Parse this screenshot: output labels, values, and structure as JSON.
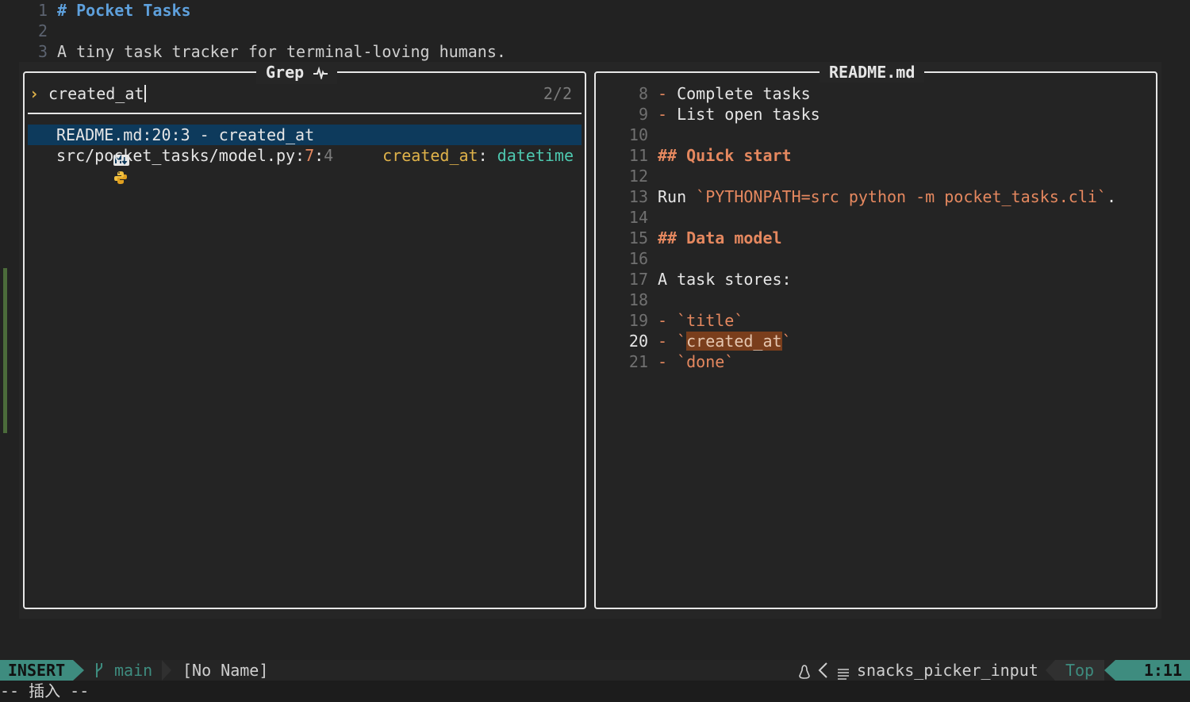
{
  "buffer": {
    "lines": [
      {
        "num": "1",
        "text": "# Pocket Tasks"
      },
      {
        "num": "2",
        "text": ""
      },
      {
        "num": "3",
        "text": "A tiny task tracker for terminal-loving humans."
      }
    ]
  },
  "picker": {
    "title": "Grep",
    "title_icon": "pulse-icon",
    "prompt_icon": "›",
    "query": "created_at",
    "count": "2/2",
    "results": [
      {
        "icon": "markdown-icon",
        "file": "README.md",
        "sep1": ":",
        "line": "20",
        "sep2": ":",
        "col": "3",
        "rest": " - created_at",
        "selected": true
      },
      {
        "icon": "python-icon",
        "file": "src/pocket_tasks/model.py",
        "sep1": ":",
        "line": "7",
        "sep2": ":",
        "col": "4",
        "match_key": "created_at",
        "match_colon": ":",
        "match_type": "datetime",
        "selected": false
      }
    ]
  },
  "preview": {
    "title": "README.md",
    "lines": [
      {
        "num": "8",
        "text": "- Complete tasks"
      },
      {
        "num": "9",
        "text": "- List open tasks"
      },
      {
        "num": "10",
        "text": ""
      },
      {
        "num": "11",
        "text": "## Quick start"
      },
      {
        "num": "12",
        "text": ""
      },
      {
        "num": "13",
        "prefix": "Run ",
        "code": "`PYTHONPATH=src python -m pocket_tasks.cli`",
        "suffix": "."
      },
      {
        "num": "14",
        "text": ""
      },
      {
        "num": "15",
        "text": "## Data model"
      },
      {
        "num": "16",
        "text": ""
      },
      {
        "num": "17",
        "text": "A task stores:"
      },
      {
        "num": "18",
        "text": ""
      },
      {
        "num": "19",
        "prefix": "- ",
        "code": "`title`"
      },
      {
        "num": "20",
        "prefix": "- ",
        "tick_open": "`",
        "highlight": "created_at",
        "tick_close": "`"
      },
      {
        "num": "21",
        "prefix": "- ",
        "code": "`done`"
      }
    ]
  },
  "statusline": {
    "mode": "INSERT",
    "branch_icon": "git-branch-icon",
    "branch": "main",
    "filename": "[No Name]",
    "os_icon": "linux-icon",
    "filetype_icon": "lines-icon",
    "filetype": "snacks_picker_input",
    "position": "Top",
    "cursor": "1:11"
  },
  "cmdline": {
    "text": "-- 插入 --"
  },
  "colors": {
    "accent_teal": "#3e8c7f",
    "selection": "#0d3a5c",
    "match_orange": "#e5885f",
    "type_teal": "#4ec9b0",
    "heading_blue": "#5ea0dc"
  }
}
